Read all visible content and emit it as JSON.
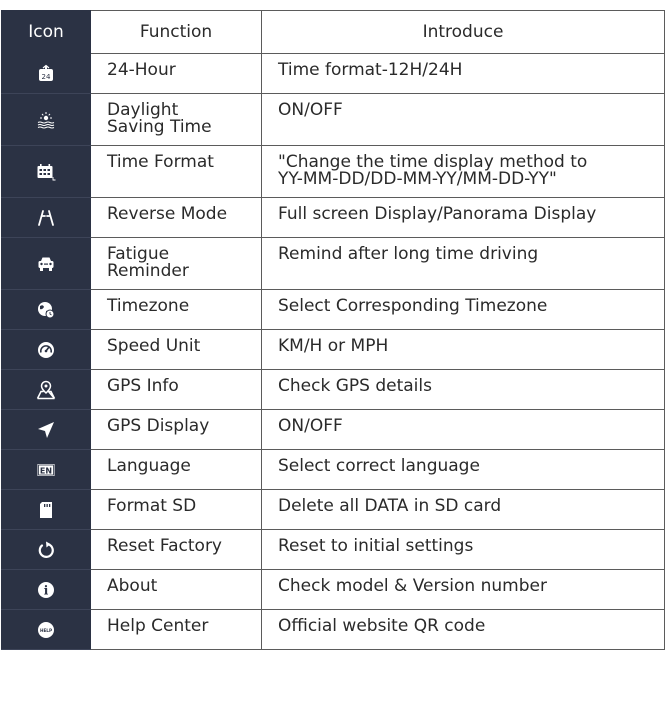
{
  "header": {
    "icon": "Icon",
    "function": "Function",
    "introduce": "Introduce"
  },
  "rows": [
    {
      "icon": "calendar-24-icon",
      "function": "24-Hour",
      "intro": "Time format-12H/24H"
    },
    {
      "icon": "sunrise-waves-icon",
      "function": "Daylight\nSaving Time",
      "intro": "ON/OFF"
    },
    {
      "icon": "calendar-grid-icon",
      "function": "Time Format",
      "intro": "\"Change the time display method to\nYY-MM-DD/DD-MM-YY/MM-DD-YY\""
    },
    {
      "icon": "reverse-lines-icon",
      "function": "Reverse Mode",
      "intro": "Full screen Display/Panorama Display"
    },
    {
      "icon": "car-icon",
      "function": "Fatigue\nReminder",
      "intro": "Remind after long time driving"
    },
    {
      "icon": "globe-clock-icon",
      "function": "Timezone",
      "intro": "Select Corresponding Timezone"
    },
    {
      "icon": "speedometer-icon",
      "function": "Speed Unit",
      "intro": "KM/H or MPH"
    },
    {
      "icon": "map-pin-icon",
      "function": "GPS Info",
      "intro": "Check GPS details"
    },
    {
      "icon": "navigation-arrow-icon",
      "function": "GPS Display",
      "intro": "ON/OFF"
    },
    {
      "icon": "language-en-icon",
      "function": "Language",
      "intro": "Select correct language"
    },
    {
      "icon": "sd-card-icon",
      "function": "Format SD",
      "intro": "Delete all DATA in SD card"
    },
    {
      "icon": "reset-icon",
      "function": "Reset Factory",
      "intro": "Reset to initial settings"
    },
    {
      "icon": "info-icon",
      "function": "About",
      "intro": "Check model & Version number"
    },
    {
      "icon": "help-icon",
      "function": "Help Center",
      "intro": "Official website QR code"
    }
  ],
  "icon_text": {
    "calendar_24": "24",
    "language": "EN",
    "help": "HELP",
    "info": "i"
  },
  "colors": {
    "icon_column": "#2b3244",
    "icon_fg": "#ffffff",
    "border": "#5b5b5b",
    "text": "#2a2a2a"
  }
}
